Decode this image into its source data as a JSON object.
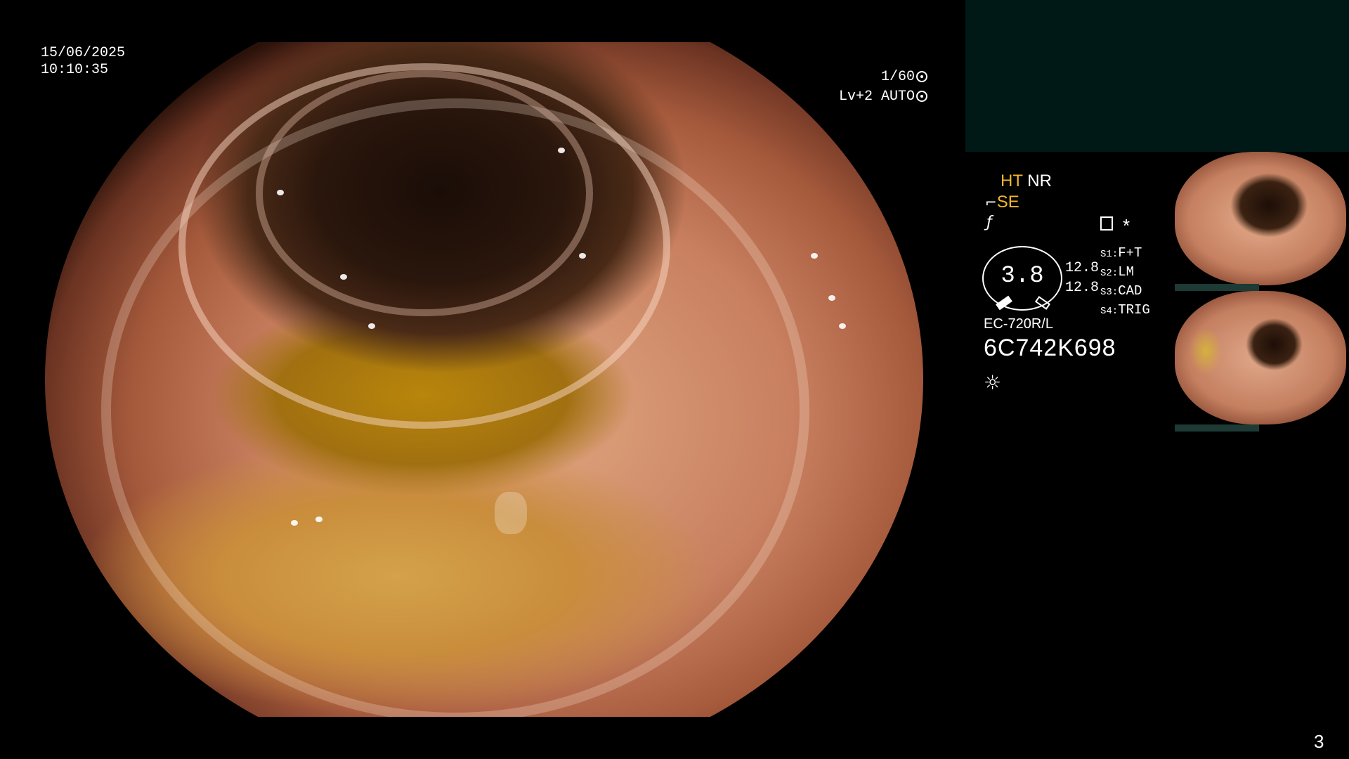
{
  "timestamp": {
    "date": "15/06/2025",
    "time": "10:10:35"
  },
  "exposure": {
    "shutter": "1/60",
    "level": "Lv+2 AUTO"
  },
  "modes": {
    "ht": "HT",
    "nr": "NR",
    "se": "SE",
    "asterisk": "*"
  },
  "gauge": {
    "value": "3.8",
    "upper": "12.8",
    "lower": "12.8"
  },
  "switches": [
    {
      "key": "S1:",
      "value": "F+T"
    },
    {
      "key": "S2:",
      "value": "LM"
    },
    {
      "key": "S3:",
      "value": "CAD"
    },
    {
      "key": "S4:",
      "value": "TRIG"
    }
  ],
  "scope": {
    "model": "EC-720R/L",
    "serial": "6C742K698"
  },
  "page_number": "3",
  "icons": {
    "shutter": "aperture-icon",
    "level": "auto-light-icon",
    "se": "structure-enhance-icon",
    "f": "filter-icon",
    "memory": "memory-card-icon",
    "light": "light-bulb-icon"
  },
  "colors": {
    "accent_yellow": "#f2b72a",
    "panel_teal": "#001917"
  }
}
